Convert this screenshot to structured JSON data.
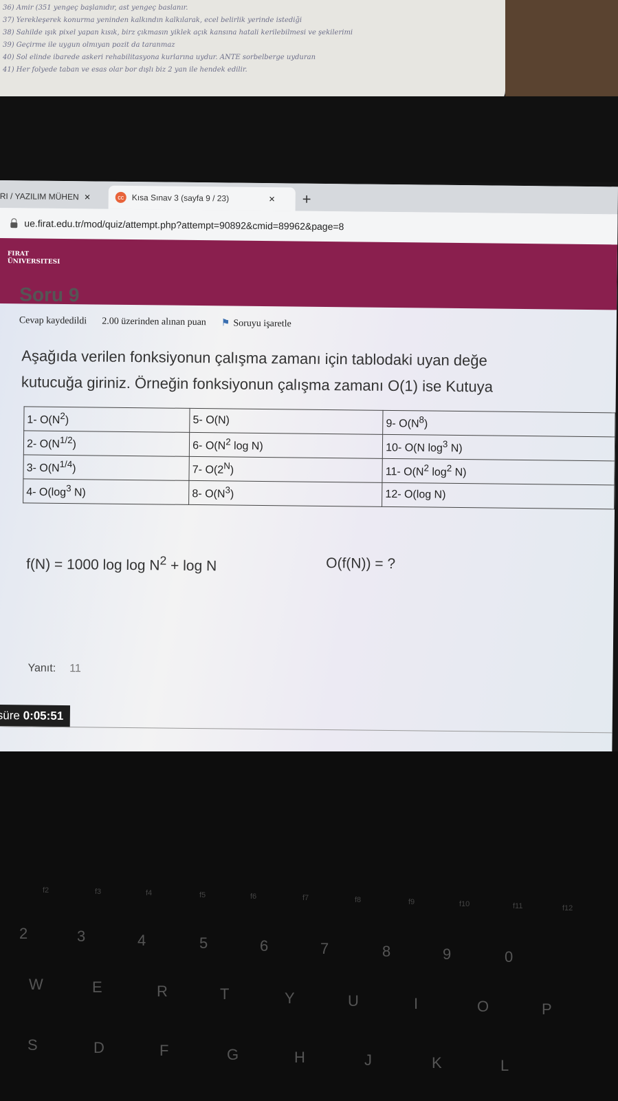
{
  "note": {
    "lines": [
      "36) Amir (351 yengeç başlanıdır, ast yengeç baslanır.",
      "37) Yerekleşerek konurma yeninden kalkındın kalkılarak, ecel belirlik yerinde istediği",
      "38) Sahilde ışık pixel yapan kısık, birz çıkmasın yiklek açık kansına hatali kerilebilmesi ve şekilerimi",
      "39) Geçirme ile uygun olmıyan pozit da taranmaz",
      "40) Sol elinde ibarede askeri rehabilitasyona kurlarına uydur. ANTE sorbelberge uyduran",
      "41) Her folyede taban ve esas olar bor dışlı biz 2 yan ile hendek edilir."
    ]
  },
  "browser": {
    "tab1_label": "RI / YAZILIM MÜHEN",
    "tab2_label": "Kısa Sınav 3 (sayfa 9 / 23)",
    "tab_close": "×",
    "new_tab": "+",
    "favicon": "cc",
    "url": "ue.firat.edu.tr/mod/quiz/attempt.php?attempt=90892&cmid=89962&page=8"
  },
  "banner": {
    "logo_line1": "FIRAT",
    "logo_line2": "ÜNIVERSITESI"
  },
  "question": {
    "title": "Soru 9",
    "status": "Cevap kaydedildi",
    "points": "2.00 üzerinden alınan puan",
    "flag_label": "Soruyu işaretle",
    "text_line1": "Aşağıda verilen fonksiyonun çalışma zamanı için tablodaki uyan değe",
    "text_line2": "kutucuğa giriniz. Örneğin fonksiyonun çalışma zamanı O(1) ise Kutuya",
    "options": {
      "o1": {
        "pre": "1- O(N",
        "sup": "2",
        "post": ")"
      },
      "o2": {
        "pre": "2- O(N",
        "sup": "1/2",
        "post": ")"
      },
      "o3": {
        "pre": "3- O(N",
        "sup": "1/4",
        "post": ")"
      },
      "o4": {
        "pre": "4- O(log",
        "sup": "3",
        "post": " N)"
      },
      "o5": {
        "pre": "5- O(N)",
        "sup": "",
        "post": ""
      },
      "o6": {
        "pre": "6- O(N",
        "sup": "2",
        "post": " log N)"
      },
      "o7": {
        "pre": "7- O(2",
        "sup": "N",
        "post": ")"
      },
      "o8": {
        "pre": "8- O(N",
        "sup": "3",
        "post": ")"
      },
      "o9": {
        "pre": "9- O(N",
        "sup": "8",
        "post": ")"
      },
      "o10": {
        "pre": "10- O(N log",
        "sup": "3",
        "post": " N)"
      },
      "o11": {
        "pre": "11- O(N",
        "sup": "2",
        "mid": " log",
        "sup2": "2",
        "post": " N)"
      },
      "o12": {
        "pre": "12- O(log N)",
        "sup": "",
        "post": ""
      }
    },
    "formula": {
      "pre": "f(N) =  1000 log log N",
      "sup": "2",
      "post": " + log N"
    },
    "target": "O(f(N)) = ?",
    "answer_label": "Yanıt:",
    "answer_value": "11"
  },
  "timer": {
    "label": "süre",
    "value": "0:05:51"
  },
  "keyboard": {
    "number_row": [
      "2",
      "3",
      "4",
      "5",
      "6",
      "7",
      "8",
      "9",
      "0"
    ],
    "top_row": [
      "W",
      "E",
      "R",
      "T",
      "Y",
      "U",
      "I",
      "O",
      "P"
    ],
    "home_row": [
      "S",
      "D",
      "F",
      "G",
      "H",
      "J",
      "K",
      "L"
    ],
    "fn_row": [
      "f2",
      "f3",
      "f4",
      "f5",
      "f6",
      "f7",
      "f8",
      "f9",
      "f10",
      "f11",
      "f12"
    ]
  }
}
